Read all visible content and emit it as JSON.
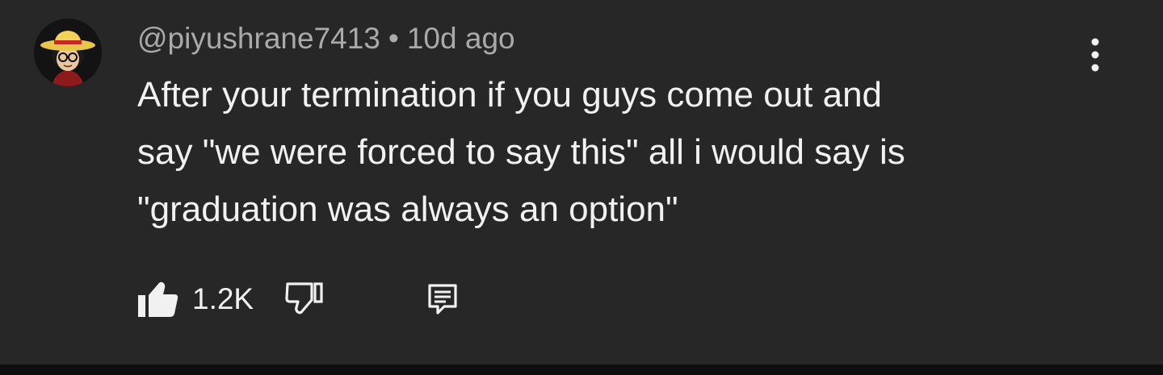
{
  "comment": {
    "author": "@piyushrane7413",
    "separator": "•",
    "time": "10d ago",
    "lines": [
      "After your termination if you guys come out and",
      "say \"we were forced to say this\" all i would say is",
      "\"graduation was always an option\""
    ],
    "like_count": "1.2K"
  },
  "icons": {
    "avatar": "straw-hat-avatar",
    "more": "more-vertical-icon",
    "like": "thumb-up-filled-icon",
    "dislike": "thumb-down-outline-icon",
    "reply": "reply-comment-icon"
  },
  "colors": {
    "background": "#272727",
    "text_primary": "#f1f1f1",
    "text_secondary": "#aaaaaa"
  }
}
